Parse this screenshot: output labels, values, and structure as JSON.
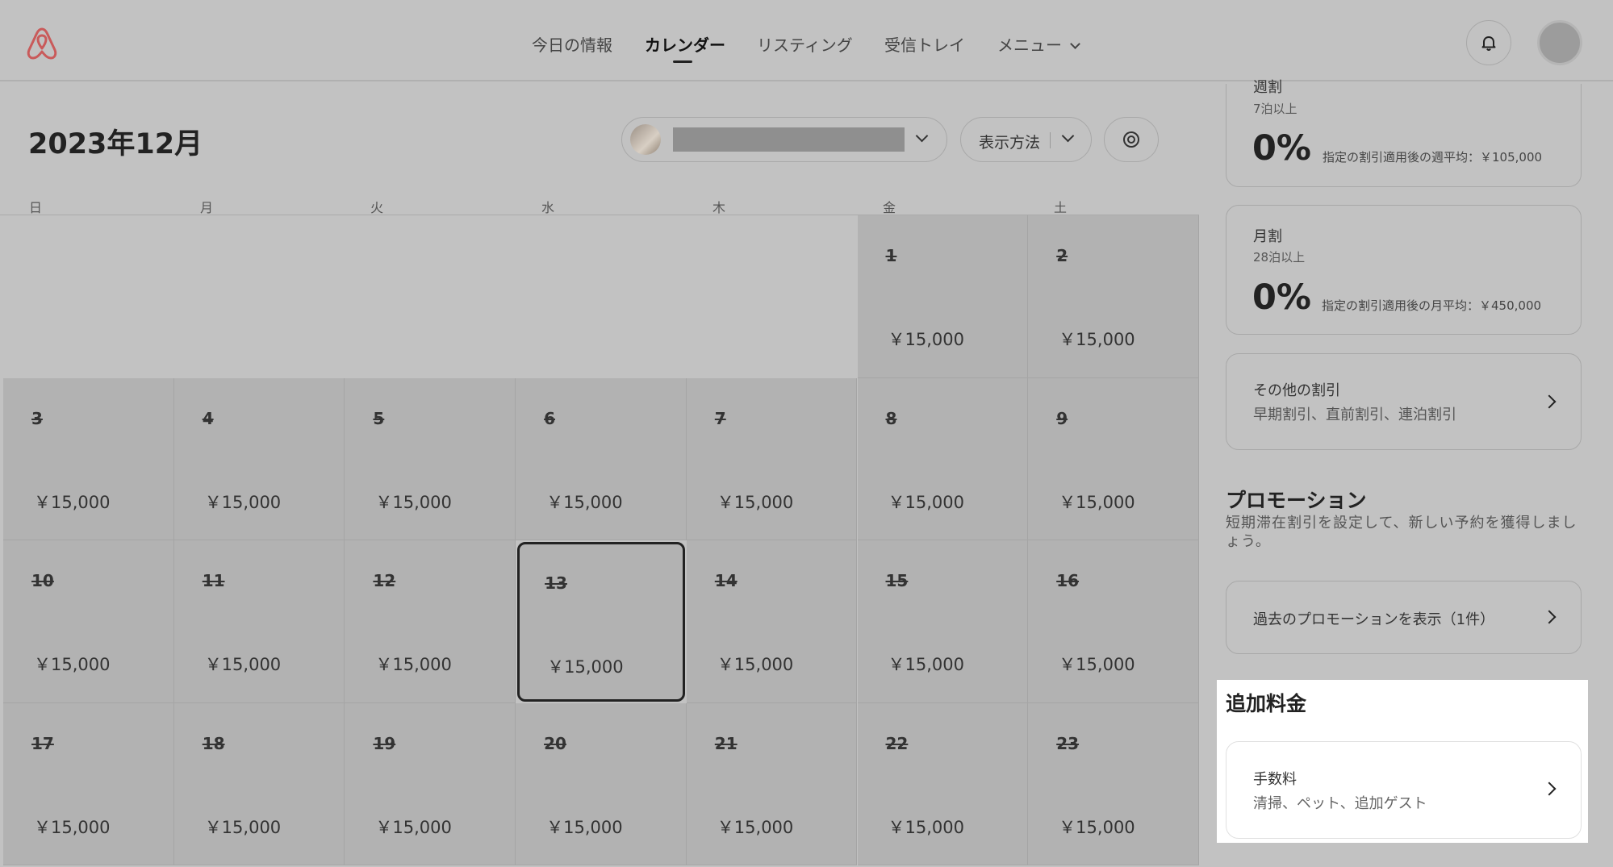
{
  "nav": {
    "items": [
      "今日の情報",
      "カレンダー",
      "リスティング",
      "受信トレイ",
      "メニュー"
    ],
    "active": "カレンダー"
  },
  "calendar": {
    "month_title": "2023年12月",
    "view_label": "表示方法",
    "weekdays": [
      "日",
      "月",
      "火",
      "水",
      "木",
      "金",
      "土"
    ],
    "price": "￥15,000",
    "days": [
      {
        "num": "1"
      },
      {
        "num": "2"
      },
      {
        "num": "3"
      },
      {
        "num": "4"
      },
      {
        "num": "5"
      },
      {
        "num": "6"
      },
      {
        "num": "7"
      },
      {
        "num": "8"
      },
      {
        "num": "9"
      },
      {
        "num": "10"
      },
      {
        "num": "11"
      },
      {
        "num": "12"
      },
      {
        "num": "13"
      },
      {
        "num": "14"
      },
      {
        "num": "15"
      },
      {
        "num": "16"
      },
      {
        "num": "17"
      },
      {
        "num": "18"
      },
      {
        "num": "19"
      },
      {
        "num": "20"
      },
      {
        "num": "21"
      },
      {
        "num": "22"
      },
      {
        "num": "23"
      }
    ],
    "selected_day": "13"
  },
  "sidebar": {
    "weekly": {
      "title": "週割",
      "sub": "7泊以上",
      "pct": "0%",
      "note": "指定の割引適用後の週平均：￥105,000"
    },
    "monthly": {
      "title": "月割",
      "sub": "28泊以上",
      "pct": "0%",
      "note": "指定の割引適用後の月平均：￥450,000"
    },
    "other": {
      "title": "その他の割引",
      "sub": "早期割引、直前割引、連泊割引"
    },
    "promotion": {
      "title": "プロモーション",
      "desc": "短期滞在割引を設定して、新しい予約を獲得しましょう。",
      "past_link": "過去のプロモーションを表示（1件）"
    },
    "fees": {
      "section_title": "追加料金",
      "title": "手数料",
      "sub": "清掃、ペット、追加ゲスト"
    }
  }
}
